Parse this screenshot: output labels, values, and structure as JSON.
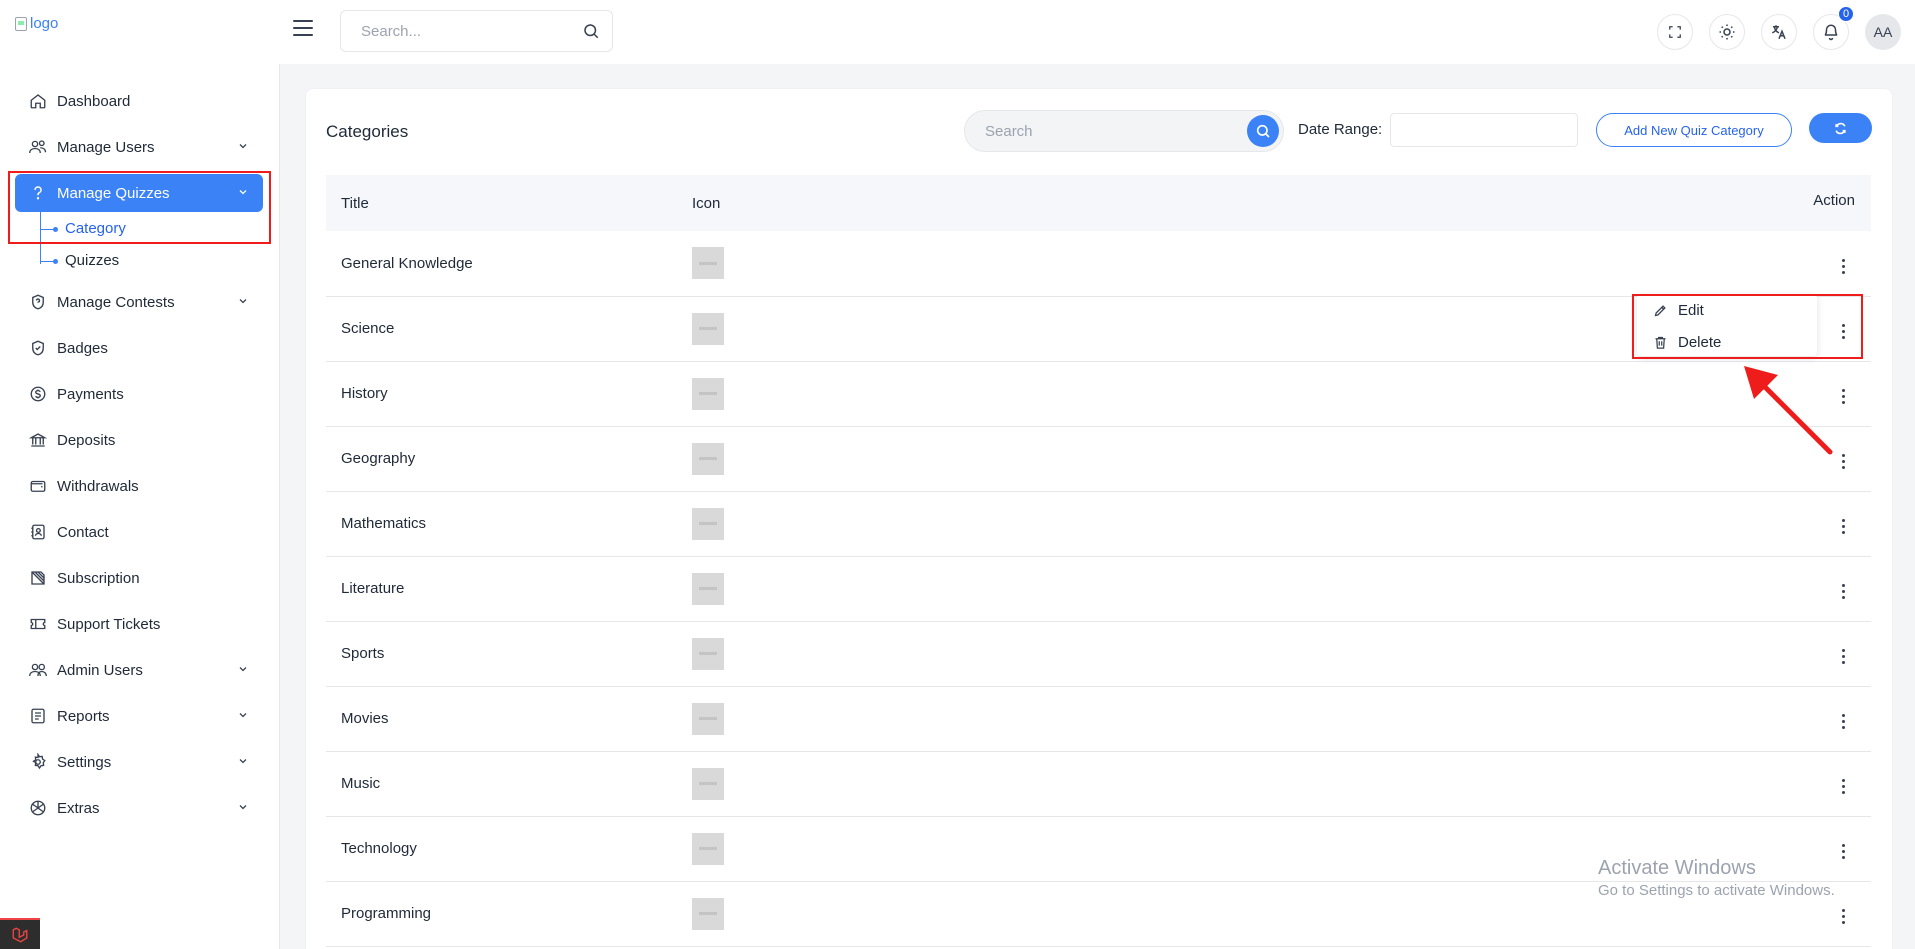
{
  "topbar": {
    "logo_alt": "logo",
    "search_placeholder": "Search...",
    "notification_count": "0",
    "avatar_initials": "AA"
  },
  "sidebar": {
    "items": [
      {
        "label": "Dashboard",
        "icon": "home-icon"
      },
      {
        "label": "Manage Users",
        "icon": "users-icon"
      },
      {
        "label": "Manage Quizzes",
        "icon": "question-icon"
      },
      {
        "label": "Manage Contests",
        "icon": "contest-icon"
      },
      {
        "label": "Badges",
        "icon": "badge-icon"
      },
      {
        "label": "Payments",
        "icon": "dollar-icon"
      },
      {
        "label": "Deposits",
        "icon": "bank-icon"
      },
      {
        "label": "Withdrawals",
        "icon": "wallet-icon"
      },
      {
        "label": "Contact",
        "icon": "contact-icon"
      },
      {
        "label": "Subscription",
        "icon": "subscription-icon"
      },
      {
        "label": "Support Tickets",
        "icon": "ticket-icon"
      },
      {
        "label": "Admin Users",
        "icon": "admin-users-icon"
      },
      {
        "label": "Reports",
        "icon": "report-icon"
      },
      {
        "label": "Settings",
        "icon": "gear-icon"
      },
      {
        "label": "Extras",
        "icon": "extras-icon"
      }
    ],
    "sub_items": [
      "Category",
      "Quizzes"
    ]
  },
  "card": {
    "title": "Categories",
    "search_placeholder": "Search",
    "date_range_label": "Date Range:",
    "add_button_label": "Add New Quiz Category"
  },
  "table": {
    "headers": {
      "title": "Title",
      "icon": "Icon",
      "action": "Action"
    },
    "rows": [
      "General Knowledge",
      "Science",
      "History",
      "Geography",
      "Mathematics",
      "Literature",
      "Sports",
      "Movies",
      "Music",
      "Technology",
      "Programming"
    ]
  },
  "dropdown": {
    "edit_label": "Edit",
    "delete_label": "Delete"
  },
  "watermark": {
    "line1": "Activate Windows",
    "line2": "Go to Settings to activate Windows."
  },
  "colors": {
    "accent": "#3b82f6",
    "highlight": "#ef1c1c"
  }
}
